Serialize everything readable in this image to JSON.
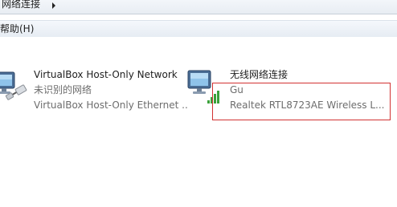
{
  "addressbar": {
    "breadcrumb_label": "网络连接"
  },
  "menubar": {
    "help_label": "帮助(H)"
  },
  "connections": [
    {
      "name": "VirtualBox Host-Only Network",
      "status": "未识别的网络",
      "device": "VirtualBox Host-Only Ethernet ...",
      "icon": "network-adapter-icon"
    },
    {
      "name": "无线网络连接",
      "status": "Gu",
      "device": "Realtek RTL8723AE Wireless L...",
      "icon": "wireless-adapter-icon",
      "signal_bars": 4
    }
  ],
  "colors": {
    "highlight": "#d23232",
    "signal": "#3aa13a"
  }
}
